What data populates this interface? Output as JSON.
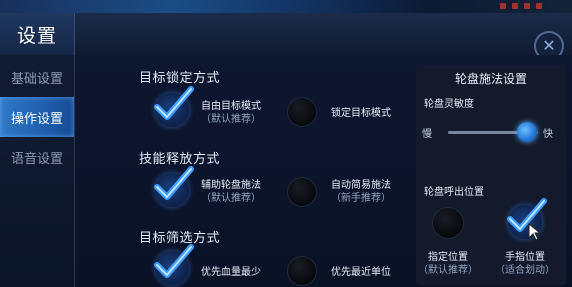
{
  "window": {
    "title": "设置",
    "close_icon": "close-icon"
  },
  "sidebar": {
    "items": [
      {
        "label": "基础设置",
        "active": false
      },
      {
        "label": "操作设置",
        "active": true
      },
      {
        "label": "语音设置",
        "active": false
      }
    ]
  },
  "target_lock": {
    "title": "目标锁定方式",
    "option1": {
      "label": "自由目标模式",
      "sub": "（默认推荐）",
      "selected": true
    },
    "option2": {
      "label": "锁定目标模式",
      "selected": false
    }
  },
  "skill_release": {
    "title": "技能释放方式",
    "option1": {
      "label": "辅助轮盘施法",
      "sub": "（默认推荐）",
      "selected": true
    },
    "option2": {
      "label": "自动简易施法",
      "sub": "（新手推荐）",
      "selected": false
    }
  },
  "target_filter": {
    "title": "目标筛选方式",
    "option1": {
      "label": "优先血量最少",
      "selected": true
    },
    "option2": {
      "label": "优先最近单位",
      "selected": false
    }
  },
  "wheel_panel": {
    "title": "轮盘施法设置",
    "sensitivity_label": "轮盘灵敏度",
    "slow_label": "慢",
    "fast_label": "快",
    "sensitivity_value": 0.88,
    "call_position_label": "轮盘呼出位置",
    "fixed": {
      "label": "指定位置",
      "sub": "（默认推荐）",
      "selected": false
    },
    "finger": {
      "label": "手指位置",
      "sub": "（适合划动）",
      "selected": true
    }
  },
  "colors": {
    "accent": "#2f78c8",
    "check": "#3a9cff",
    "background": "#0b1226"
  }
}
